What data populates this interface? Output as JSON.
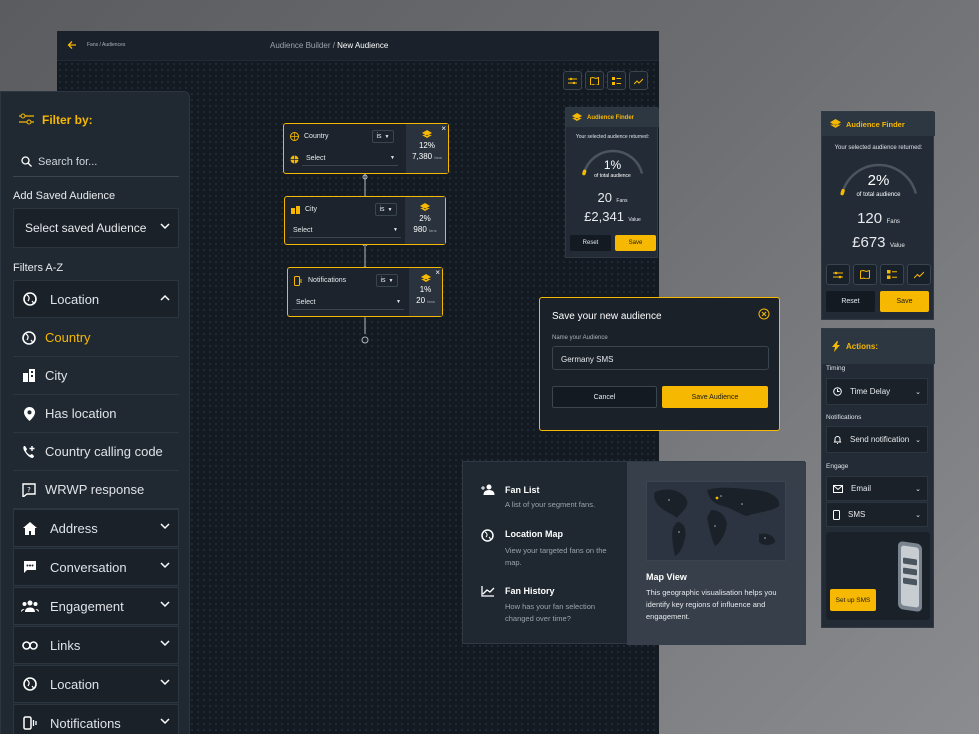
{
  "canvas": {
    "breadcrumb": "Fans / Audiences",
    "title_prefix": "Audience Builder / ",
    "title_current": "New Audience",
    "nodes": [
      {
        "label": "Country",
        "operator": "is",
        "select": "Select",
        "percent": "12%",
        "fans": "7,380",
        "fans_unit": "fans"
      },
      {
        "label": "City",
        "operator": "is",
        "select": "Select",
        "percent": "2%",
        "fans": "980",
        "fans_unit": "fans"
      },
      {
        "label": "Notifications",
        "operator": "is",
        "select": "Select",
        "percent": "1%",
        "fans": "20",
        "fans_unit": "fans"
      }
    ]
  },
  "filter": {
    "title": "Filter by:",
    "search_placeholder": "Search for...",
    "saved_label": "Add Saved Audience",
    "saved_select": "Select saved Audience",
    "az_label": "Filters A-Z",
    "items": [
      "Location",
      "Country",
      "City",
      "Has location",
      "Country calling code",
      "WRWP response",
      "Address",
      "Conversation",
      "Engagement",
      "Links",
      "Location",
      "Notifications"
    ]
  },
  "finder_small": {
    "title": "Audience Finder",
    "subtitle": "Your selected audience returned:",
    "percent": "1%",
    "percent_label": "of total audience",
    "gauge_fraction": 0.01,
    "fans": "20",
    "fans_label": "Fans",
    "value": "£2,341",
    "value_label": "Value",
    "reset": "Reset",
    "save": "Save"
  },
  "finder_large": {
    "title": "Audience Finder",
    "subtitle": "Your selected audience returned:",
    "percent": "2%",
    "percent_label": "of total audience",
    "gauge_fraction": 0.02,
    "fans": "120",
    "fans_label": "Fans",
    "value": "£673",
    "value_label": "Value",
    "reset": "Reset",
    "save": "Save"
  },
  "save_dialog": {
    "title": "Save your new audience",
    "field_label": "Name your Audience",
    "field_value": "Germany SMS",
    "cancel": "Cancel",
    "save": "Save Audience"
  },
  "views": {
    "items": [
      {
        "title": "Fan List",
        "desc": "A list of your segment fans."
      },
      {
        "title": "Location Map",
        "desc": "View your targeted fans on the map."
      },
      {
        "title": "Fan History",
        "desc": "How has your fan selection changed over time?"
      }
    ],
    "map_title": "Map View",
    "map_desc": "This geographic visualisation helps you identify key regions of influence and engagement."
  },
  "actions": {
    "title": "Actions:",
    "timing_label": "Timing",
    "timing_value": "Time Delay",
    "notifications_label": "Notifications",
    "notifications_value": "Send notification",
    "engage_label": "Engage",
    "engage_email": "Email",
    "engage_sms": "SMS",
    "cta": "Set up SMS"
  },
  "colors": {
    "accent": "#f6b800",
    "bg_dark": "#141a22",
    "panel": "#232c36"
  }
}
